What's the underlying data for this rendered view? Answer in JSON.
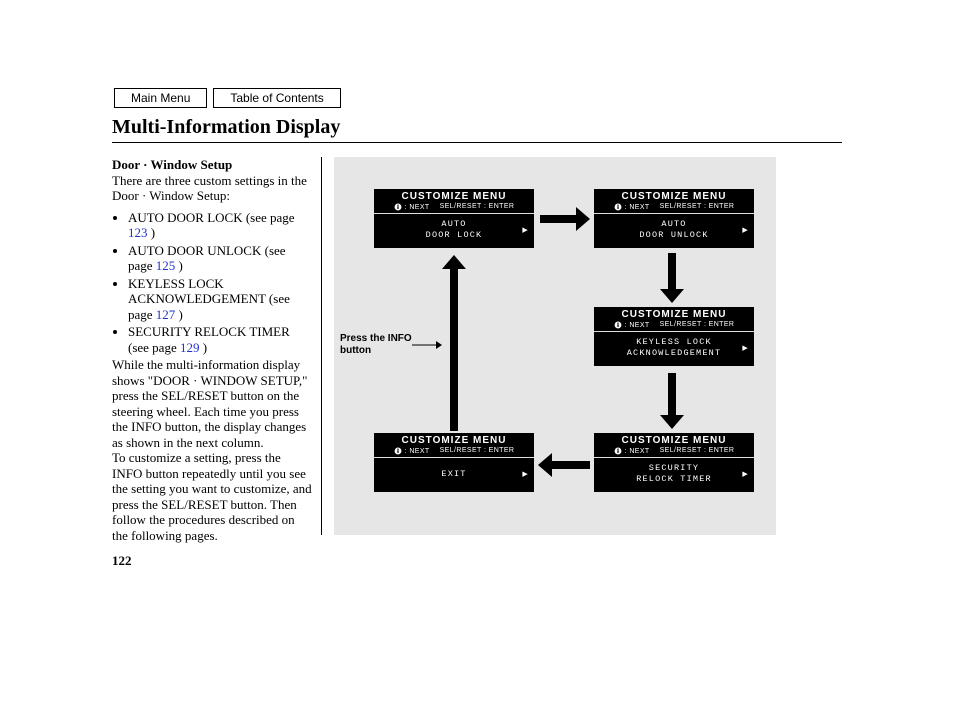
{
  "nav": {
    "main_menu": "Main Menu",
    "toc": "Table of Contents"
  },
  "title": "Multi-Information Display",
  "left": {
    "subhead": "Door · Window Setup",
    "intro": "There are three custom settings in the Door · Window Setup:",
    "items": [
      {
        "label": "AUTO DOOR LOCK (see page ",
        "page": "123",
        "tail": " )"
      },
      {
        "label": "AUTO DOOR UNLOCK (see page ",
        "page": "125",
        "tail": " )"
      },
      {
        "label": "KEYLESS LOCK ACKNOWLEDGEMENT (see page ",
        "page": "127",
        "tail": " )"
      },
      {
        "label": "SECURITY RELOCK TIMER (see page ",
        "page": "129",
        "tail": " )"
      }
    ],
    "para1": "While the multi-information display shows \"DOOR · WINDOW SETUP,\" press the SEL/RESET button on the steering wheel. Each time you press the INFO button, the display changes as shown in the next column.",
    "para2": "To customize a setting, press the INFO button repeatedly until you see the setting you want to customize, and press the SEL/RESET button. Then follow the procedures described on the following pages."
  },
  "diagram": {
    "note": "Press the INFO button",
    "screen_header": "CUSTOMIZE MENU",
    "screen_sub_left": ": NEXT",
    "screen_sub_right": "SEL/RESET : ENTER",
    "chevron": "▶",
    "screens": {
      "s1": {
        "line1": "AUTO",
        "line2": "DOOR LOCK"
      },
      "s2": {
        "line1": "AUTO",
        "line2": "DOOR UNLOCK"
      },
      "s3": {
        "line1": "KEYLESS LOCK",
        "line2": "ACKNOWLEDGEMENT"
      },
      "s4": {
        "line1": "SECURITY",
        "line2": "RELOCK TIMER"
      },
      "s5": {
        "line1": "EXIT",
        "line2": ""
      }
    }
  },
  "page_number": "122"
}
